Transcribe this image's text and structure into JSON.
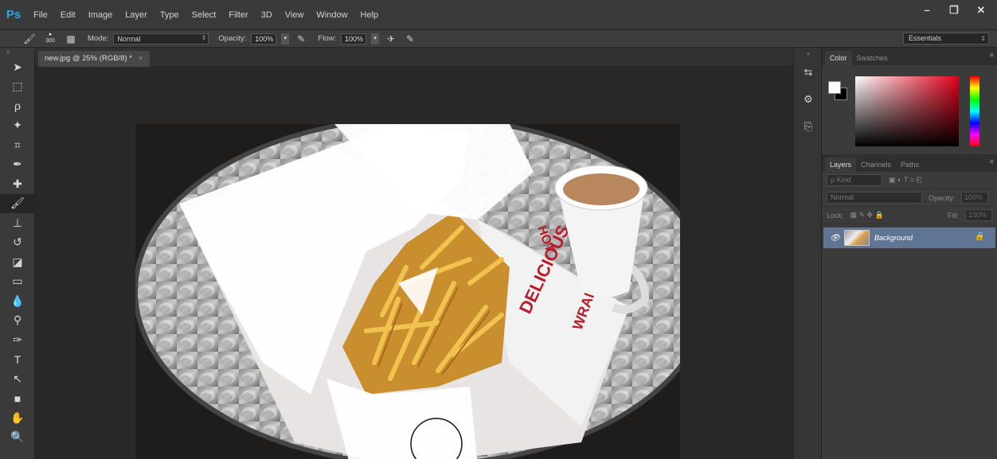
{
  "app": {
    "logo": "Ps"
  },
  "menu": [
    "File",
    "Edit",
    "Image",
    "Layer",
    "Type",
    "Select",
    "Filter",
    "3D",
    "View",
    "Window",
    "Help"
  ],
  "window_controls": {
    "minimize": "–",
    "restore": "❐",
    "close": "✕"
  },
  "options": {
    "brush_size": "300",
    "mode_label": "Mode:",
    "mode_value": "Normal",
    "opacity_label": "Opacity:",
    "opacity_value": "100%",
    "flow_label": "Flow:",
    "flow_value": "100%",
    "workspace": "Essentials"
  },
  "document_tab": {
    "title": "new.jpg @ 25% (RGB/8) *",
    "close": "×"
  },
  "tools": [
    "move-tool",
    "marquee-tool",
    "lasso-tool",
    "quick-select-tool",
    "crop-tool",
    "eyedropper-tool",
    "healing-brush-tool",
    "brush-tool",
    "clone-stamp-tool",
    "history-brush-tool",
    "eraser-tool",
    "gradient-tool",
    "blur-tool",
    "dodge-tool",
    "pen-tool",
    "type-tool",
    "path-select-tool",
    "rectangle-tool",
    "hand-tool",
    "zoom-tool"
  ],
  "color_panel": {
    "tabs": [
      "Color",
      "Swatches"
    ],
    "fg": "#ffffff",
    "bg": "#000000"
  },
  "layers_panel": {
    "tabs": [
      "Layers",
      "Channels",
      "Paths"
    ],
    "kind_label": "ρ Kind",
    "blend_mode": "Normal",
    "opacity_label": "Opacity:",
    "opacity_value": "100%",
    "lock_label": "Lock:",
    "fill_label": "Fill:",
    "fill_value": "100%",
    "layers": [
      {
        "name": "Background",
        "visible": true,
        "locked": true
      }
    ]
  },
  "canvas_texts": {
    "wrap_text_1": "WRAP",
    "wrap_text_2": "HOT",
    "wrap_text_3": "DELICIOUS"
  }
}
